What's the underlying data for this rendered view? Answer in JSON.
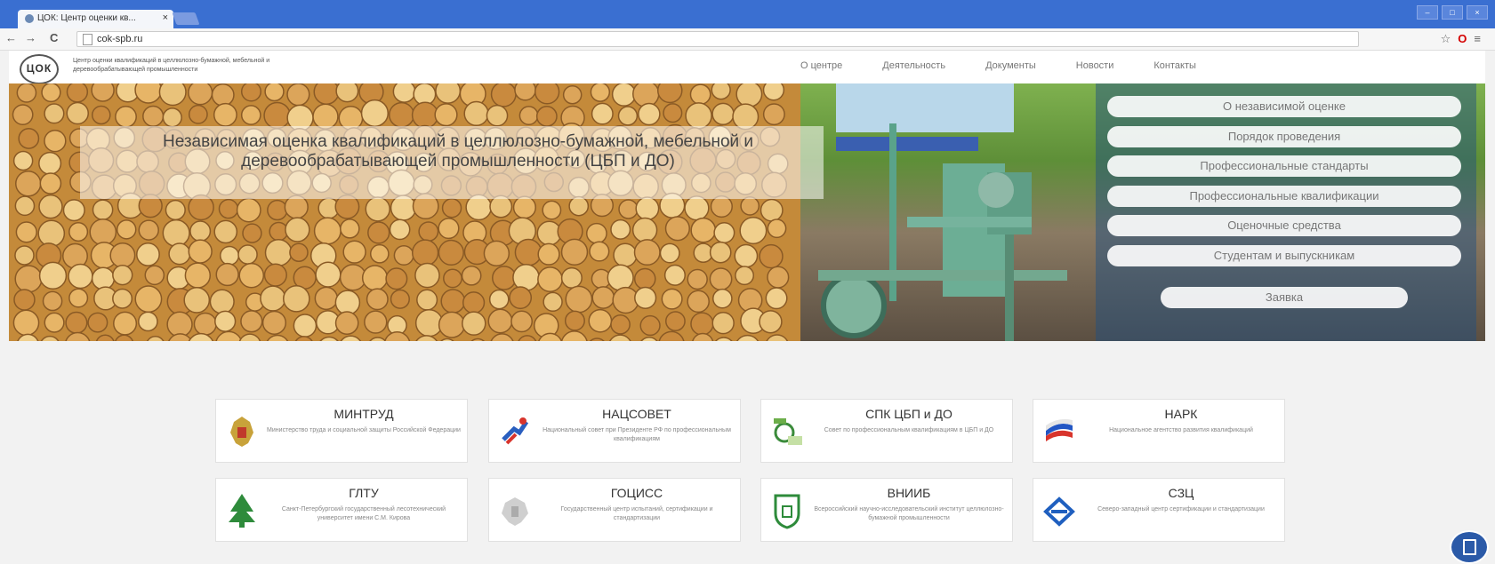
{
  "browser": {
    "tab_title": "ЦОК: Центр оценки кв...",
    "tab_close": "×",
    "url": "cok-spb.ru",
    "back": "←",
    "forward": "→",
    "reload": "C",
    "star": "☆",
    "opera": "O",
    "menu": "≡",
    "window_buttons": [
      "–",
      "□",
      "×"
    ]
  },
  "header": {
    "logo_text": "ЦОК",
    "tagline": "Центр оценки квалификаций в целлюлозно-бумажной, мебельной и деревообрабатывающей промышленности",
    "menu": [
      "О центре",
      "Деятельность",
      "Документы",
      "Новости",
      "Контакты"
    ]
  },
  "hero": {
    "headline": "Независимая оценка квалификаций в целлюлозно-бумажной, мебельной и деревообрабатывающей промышленности (ЦБП и ДО)"
  },
  "side_menu": {
    "items": [
      "О независимой оценке",
      "Порядок проведения",
      "Профессиональные стандарты",
      "Профессиональные квалификации",
      "Оценочные средства",
      "Студентам и выпускникам"
    ],
    "apply": "Заявка"
  },
  "partners": [
    {
      "title": "МИНТРУД",
      "desc": "Министерство труда и социальной защиты Российской Федерации",
      "icon": "emblem-icon"
    },
    {
      "title": "НАЦСОВЕТ",
      "desc": "Национальный совет при Президенте РФ по профессиональным квалификациям",
      "icon": "runner-icon"
    },
    {
      "title": "СПК ЦБП и ДО",
      "desc": "Совет по профессиональным квалификациям в ЦБП и ДО",
      "icon": "spk-icon"
    },
    {
      "title": "НАРК",
      "desc": "Национальное агентство развития квалификаций",
      "icon": "flag-icon"
    },
    {
      "title": "ГЛТУ",
      "desc": "Санкт-Петербургский государственный лесотехнический университет имени С.М. Кирова",
      "icon": "tree-icon"
    },
    {
      "title": "ГОЦИСС",
      "desc": "Государственный центр испытаний, сертификации и стандартизации",
      "icon": "eagle-icon"
    },
    {
      "title": "ВНИИБ",
      "desc": "Всероссийский научно-исследовательский институт целлюлозно-бумажной промышленности",
      "icon": "shield-icon"
    },
    {
      "title": "СЗЦ",
      "desc": "Северо-западный центр сертификации и стандартизации",
      "icon": "szc-icon"
    }
  ],
  "colors": {
    "chrome": "#3a6fd1",
    "side_overlay": "#205082",
    "page_bg": "#f2f2f2",
    "float_button": "#2b5aa8"
  }
}
